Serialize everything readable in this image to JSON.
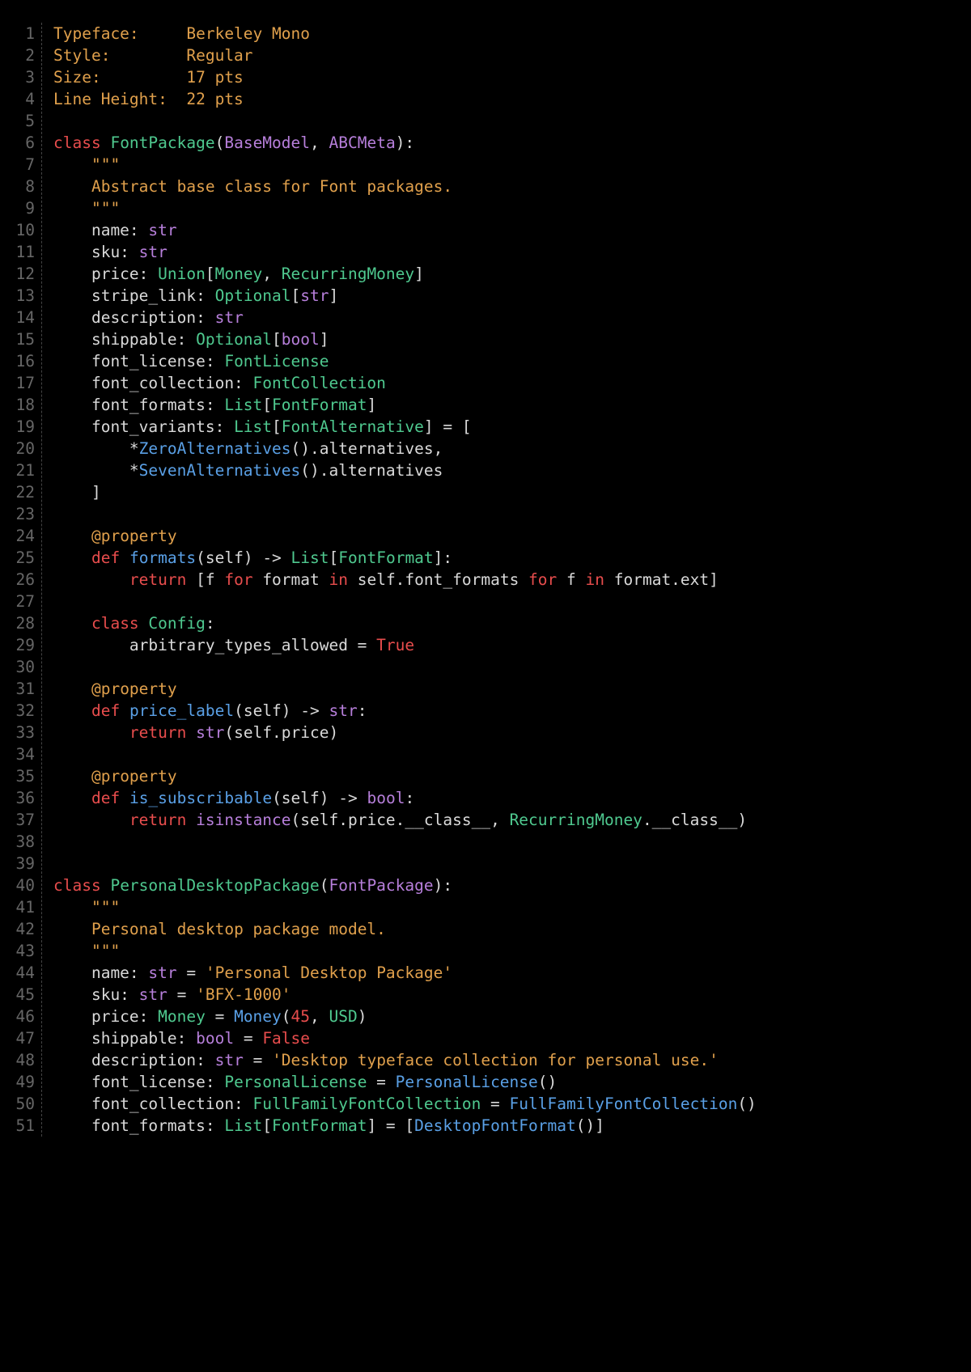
{
  "metadata_block": {
    "typeface_label": "Typeface:",
    "typeface_value": "Berkeley Mono",
    "style_label": "Style:",
    "style_value": "Regular",
    "size_label": "Size:",
    "size_value": "17 pts",
    "lineheight_label": "Line Height:",
    "lineheight_value": "22 pts"
  },
  "gutter": {
    "start": 1,
    "end": 51
  },
  "colors": {
    "keyword_red": "#e84d4d",
    "type_green": "#4fc98f",
    "builtin_purple": "#b77fdb",
    "func_blue": "#5aa0e6",
    "docstring_orange": "#e0a04c",
    "punct_gray": "#bcbcbc",
    "linenum_gray": "#666666",
    "background": "#000000"
  },
  "code_lines": [
    [
      {
        "t": "Typeface:     Berkeley Mono",
        "c": "c-orange"
      }
    ],
    [
      {
        "t": "Style:        Regular",
        "c": "c-orange"
      }
    ],
    [
      {
        "t": "Size:         17 pts",
        "c": "c-orange"
      }
    ],
    [
      {
        "t": "Line Height:  22 pts",
        "c": "c-orange"
      }
    ],
    [],
    [
      {
        "t": "class",
        "c": "c-red"
      },
      {
        "t": " "
      },
      {
        "t": "FontPackage",
        "c": "c-green"
      },
      {
        "t": "("
      },
      {
        "t": "BaseModel",
        "c": "c-purple"
      },
      {
        "t": ", "
      },
      {
        "t": "ABCMeta",
        "c": "c-purple"
      },
      {
        "t": "):"
      }
    ],
    [
      {
        "t": "    "
      },
      {
        "t": "\"\"\"",
        "c": "c-orange"
      }
    ],
    [
      {
        "t": "    "
      },
      {
        "t": "Abstract base class for Font packages.",
        "c": "c-orange"
      }
    ],
    [
      {
        "t": "    "
      },
      {
        "t": "\"\"\"",
        "c": "c-orange"
      }
    ],
    [
      {
        "t": "    name: "
      },
      {
        "t": "str",
        "c": "c-purple"
      }
    ],
    [
      {
        "t": "    sku: "
      },
      {
        "t": "str",
        "c": "c-purple"
      }
    ],
    [
      {
        "t": "    price: "
      },
      {
        "t": "Union",
        "c": "c-green"
      },
      {
        "t": "["
      },
      {
        "t": "Money",
        "c": "c-green"
      },
      {
        "t": ", "
      },
      {
        "t": "RecurringMoney",
        "c": "c-green"
      },
      {
        "t": "]"
      }
    ],
    [
      {
        "t": "    stripe_link: "
      },
      {
        "t": "Optional",
        "c": "c-green"
      },
      {
        "t": "["
      },
      {
        "t": "str",
        "c": "c-purple"
      },
      {
        "t": "]"
      }
    ],
    [
      {
        "t": "    description: "
      },
      {
        "t": "str",
        "c": "c-purple"
      }
    ],
    [
      {
        "t": "    shippable: "
      },
      {
        "t": "Optional",
        "c": "c-green"
      },
      {
        "t": "["
      },
      {
        "t": "bool",
        "c": "c-purple"
      },
      {
        "t": "]"
      }
    ],
    [
      {
        "t": "    font_license: "
      },
      {
        "t": "FontLicense",
        "c": "c-green"
      }
    ],
    [
      {
        "t": "    font_collection: "
      },
      {
        "t": "FontCollection",
        "c": "c-green"
      }
    ],
    [
      {
        "t": "    font_formats: "
      },
      {
        "t": "List",
        "c": "c-green"
      },
      {
        "t": "["
      },
      {
        "t": "FontFormat",
        "c": "c-green"
      },
      {
        "t": "]"
      }
    ],
    [
      {
        "t": "    font_variants: "
      },
      {
        "t": "List",
        "c": "c-green"
      },
      {
        "t": "["
      },
      {
        "t": "FontAlternative",
        "c": "c-green"
      },
      {
        "t": "] = ["
      }
    ],
    [
      {
        "t": "        *"
      },
      {
        "t": "ZeroAlternatives",
        "c": "c-blue"
      },
      {
        "t": "().alternatives,"
      }
    ],
    [
      {
        "t": "        *"
      },
      {
        "t": "SevenAlternatives",
        "c": "c-blue"
      },
      {
        "t": "().alternatives"
      }
    ],
    [
      {
        "t": "    ]"
      }
    ],
    [],
    [
      {
        "t": "    "
      },
      {
        "t": "@property",
        "c": "c-orange"
      }
    ],
    [
      {
        "t": "    "
      },
      {
        "t": "def",
        "c": "c-red"
      },
      {
        "t": " "
      },
      {
        "t": "formats",
        "c": "c-blue"
      },
      {
        "t": "(self) -> "
      },
      {
        "t": "List",
        "c": "c-green"
      },
      {
        "t": "["
      },
      {
        "t": "FontFormat",
        "c": "c-green"
      },
      {
        "t": "]:"
      }
    ],
    [
      {
        "t": "        "
      },
      {
        "t": "return",
        "c": "c-red"
      },
      {
        "t": " [f "
      },
      {
        "t": "for",
        "c": "c-red"
      },
      {
        "t": " format "
      },
      {
        "t": "in",
        "c": "c-red"
      },
      {
        "t": " self.font_formats "
      },
      {
        "t": "for",
        "c": "c-red"
      },
      {
        "t": " f "
      },
      {
        "t": "in",
        "c": "c-red"
      },
      {
        "t": " format.ext]"
      }
    ],
    [],
    [
      {
        "t": "    "
      },
      {
        "t": "class",
        "c": "c-red"
      },
      {
        "t": " "
      },
      {
        "t": "Config",
        "c": "c-green"
      },
      {
        "t": ":"
      }
    ],
    [
      {
        "t": "        arbitrary_types_allowed = "
      },
      {
        "t": "True",
        "c": "c-red"
      }
    ],
    [],
    [
      {
        "t": "    "
      },
      {
        "t": "@property",
        "c": "c-orange"
      }
    ],
    [
      {
        "t": "    "
      },
      {
        "t": "def",
        "c": "c-red"
      },
      {
        "t": " "
      },
      {
        "t": "price_label",
        "c": "c-blue"
      },
      {
        "t": "(self) -> "
      },
      {
        "t": "str",
        "c": "c-purple"
      },
      {
        "t": ":"
      }
    ],
    [
      {
        "t": "        "
      },
      {
        "t": "return",
        "c": "c-red"
      },
      {
        "t": " "
      },
      {
        "t": "str",
        "c": "c-purple"
      },
      {
        "t": "(self.price)"
      }
    ],
    [],
    [
      {
        "t": "    "
      },
      {
        "t": "@property",
        "c": "c-orange"
      }
    ],
    [
      {
        "t": "    "
      },
      {
        "t": "def",
        "c": "c-red"
      },
      {
        "t": " "
      },
      {
        "t": "is_subscribable",
        "c": "c-blue"
      },
      {
        "t": "(self) -> "
      },
      {
        "t": "bool",
        "c": "c-purple"
      },
      {
        "t": ":"
      }
    ],
    [
      {
        "t": "        "
      },
      {
        "t": "return",
        "c": "c-red"
      },
      {
        "t": " "
      },
      {
        "t": "isinstance",
        "c": "c-purple"
      },
      {
        "t": "(self.price.__class__, "
      },
      {
        "t": "RecurringMoney",
        "c": "c-green"
      },
      {
        "t": ".__class__)"
      }
    ],
    [],
    [],
    [
      {
        "t": "class",
        "c": "c-red"
      },
      {
        "t": " "
      },
      {
        "t": "PersonalDesktopPackage",
        "c": "c-green"
      },
      {
        "t": "("
      },
      {
        "t": "FontPackage",
        "c": "c-purple"
      },
      {
        "t": "):"
      }
    ],
    [
      {
        "t": "    "
      },
      {
        "t": "\"\"\"",
        "c": "c-orange"
      }
    ],
    [
      {
        "t": "    "
      },
      {
        "t": "Personal desktop package model.",
        "c": "c-orange"
      }
    ],
    [
      {
        "t": "    "
      },
      {
        "t": "\"\"\"",
        "c": "c-orange"
      }
    ],
    [
      {
        "t": "    name: "
      },
      {
        "t": "str",
        "c": "c-purple"
      },
      {
        "t": " = "
      },
      {
        "t": "'Personal Desktop Package'",
        "c": "c-orange"
      }
    ],
    [
      {
        "t": "    sku: "
      },
      {
        "t": "str",
        "c": "c-purple"
      },
      {
        "t": " = "
      },
      {
        "t": "'BFX-1000'",
        "c": "c-orange"
      }
    ],
    [
      {
        "t": "    price: "
      },
      {
        "t": "Money",
        "c": "c-green"
      },
      {
        "t": " = "
      },
      {
        "t": "Money",
        "c": "c-blue"
      },
      {
        "t": "("
      },
      {
        "t": "45",
        "c": "c-red"
      },
      {
        "t": ", "
      },
      {
        "t": "USD",
        "c": "c-green"
      },
      {
        "t": ")"
      }
    ],
    [
      {
        "t": "    shippable: "
      },
      {
        "t": "bool",
        "c": "c-purple"
      },
      {
        "t": " = "
      },
      {
        "t": "False",
        "c": "c-red"
      }
    ],
    [
      {
        "t": "    description: "
      },
      {
        "t": "str",
        "c": "c-purple"
      },
      {
        "t": " = "
      },
      {
        "t": "'Desktop typeface collection for personal use.'",
        "c": "c-orange"
      }
    ],
    [
      {
        "t": "    font_license: "
      },
      {
        "t": "PersonalLicense",
        "c": "c-green"
      },
      {
        "t": " = "
      },
      {
        "t": "PersonalLicense",
        "c": "c-blue"
      },
      {
        "t": "()"
      }
    ],
    [
      {
        "t": "    font_collection: "
      },
      {
        "t": "FullFamilyFontCollection",
        "c": "c-green"
      },
      {
        "t": " = "
      },
      {
        "t": "FullFamilyFontCollection",
        "c": "c-blue"
      },
      {
        "t": "()"
      }
    ],
    [
      {
        "t": "    font_formats: "
      },
      {
        "t": "List",
        "c": "c-green"
      },
      {
        "t": "["
      },
      {
        "t": "FontFormat",
        "c": "c-green"
      },
      {
        "t": "] = ["
      },
      {
        "t": "DesktopFontFormat",
        "c": "c-blue"
      },
      {
        "t": "()]"
      }
    ]
  ]
}
